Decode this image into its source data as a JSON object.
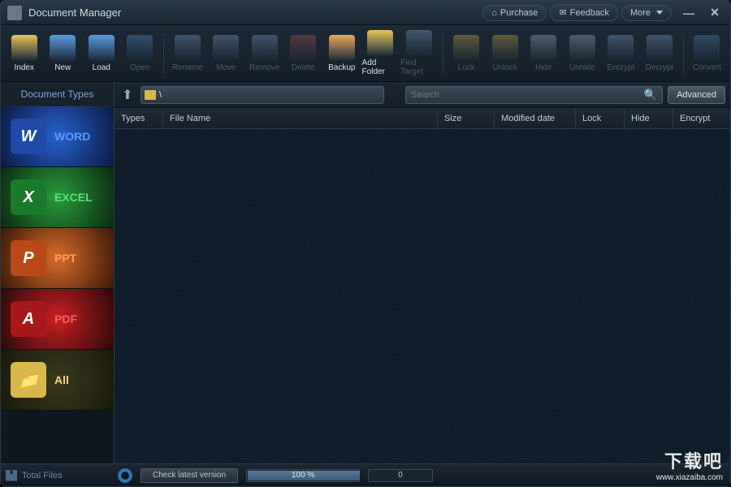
{
  "title": "Document Manager",
  "titlebar_buttons": {
    "purchase": "Purchase",
    "feedback": "Feedback",
    "more": "More"
  },
  "toolbar": [
    {
      "id": "index",
      "label": "Index",
      "enabled": true,
      "color": "#e8c45a"
    },
    {
      "id": "new",
      "label": "New",
      "enabled": true,
      "color": "#5a9ae0"
    },
    {
      "id": "load",
      "label": "Load",
      "enabled": true,
      "color": "#5a9ae0"
    },
    {
      "id": "open",
      "label": "Open",
      "enabled": false,
      "color": "#5a9ae0"
    },
    {
      "sep": true
    },
    {
      "id": "rename",
      "label": "Rename",
      "enabled": false,
      "color": "#8aaad0"
    },
    {
      "id": "move",
      "label": "Move",
      "enabled": false,
      "color": "#8aaad0"
    },
    {
      "id": "remove",
      "label": "Remove",
      "enabled": false,
      "color": "#8aaad0"
    },
    {
      "id": "delete",
      "label": "Delete",
      "enabled": false,
      "color": "#c05a5a"
    },
    {
      "id": "backup",
      "label": "Backup",
      "enabled": true,
      "color": "#e8a85a"
    },
    {
      "id": "addfolder",
      "label": "Add Folder",
      "enabled": true,
      "color": "#e8c45a"
    },
    {
      "id": "findtarget",
      "label": "Find Target",
      "enabled": false,
      "color": "#8aaad0"
    },
    {
      "sep": true
    },
    {
      "id": "lock",
      "label": "Lock",
      "enabled": false,
      "color": "#d8b84a"
    },
    {
      "id": "unlock",
      "label": "Unlock",
      "enabled": false,
      "color": "#d8b84a"
    },
    {
      "id": "hide",
      "label": "Hide",
      "enabled": false,
      "color": "#b0c0d0"
    },
    {
      "id": "unhide",
      "label": "Unhide",
      "enabled": false,
      "color": "#b0c0d0"
    },
    {
      "id": "encrypt",
      "label": "Encrypt",
      "enabled": false,
      "color": "#8aaad0"
    },
    {
      "id": "decrypt",
      "label": "Decrypt",
      "enabled": false,
      "color": "#8aaad0"
    },
    {
      "sep": true
    },
    {
      "id": "convert",
      "label": "Convert",
      "enabled": false,
      "color": "#5a8ac0"
    }
  ],
  "sidebar_header": "Document Types",
  "types": [
    {
      "id": "word",
      "label": "WORD",
      "glyph": "W",
      "cls": "tc-word"
    },
    {
      "id": "excel",
      "label": "EXCEL",
      "glyph": "X",
      "cls": "tc-excel"
    },
    {
      "id": "ppt",
      "label": "PPT",
      "glyph": "P",
      "cls": "tc-ppt"
    },
    {
      "id": "pdf",
      "label": "PDF",
      "glyph": "A",
      "cls": "tc-pdf"
    },
    {
      "id": "all",
      "label": "All",
      "glyph": "📁",
      "cls": "tc-all"
    }
  ],
  "path": "\\",
  "search_placeholder": "Search",
  "advanced_label": "Advanced",
  "columns": {
    "types": "Types",
    "name": "File Name",
    "size": "Size",
    "mod": "Modified date",
    "lock": "Lock",
    "hide": "Hide",
    "enc": "Encrypt"
  },
  "status": {
    "total_label": "Total Files",
    "check": "Check latest version",
    "progress_text": "100 %",
    "progress_pct": 100,
    "count": "0"
  },
  "watermark": {
    "big": "下载吧",
    "url": "www.xiazaiba.com"
  }
}
